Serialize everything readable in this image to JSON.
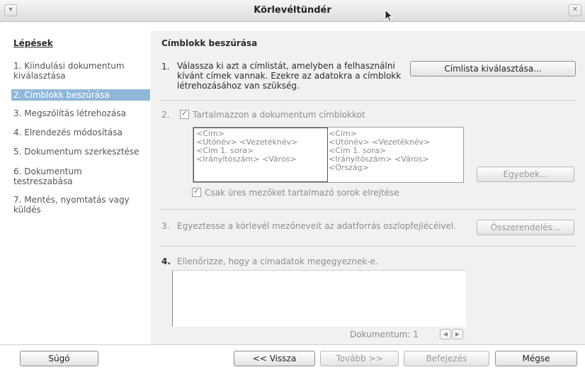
{
  "window": {
    "title": "Körlevéltündér",
    "menu_icon": "chevron-down-icon",
    "close_icon": "close-icon"
  },
  "sidebar": {
    "heading": "Lépések",
    "items": [
      {
        "label": "1. Kiindulási dokumentum kiválasztása",
        "active": false
      },
      {
        "label": "2. Címblokk beszúrása",
        "active": true
      },
      {
        "label": "3. Megszólítás létrehozása",
        "active": false
      },
      {
        "label": "4. Elrendezés módosítása",
        "active": false
      },
      {
        "label": "5. Dokumentum szerkesztése",
        "active": false
      },
      {
        "label": "6. Dokumentum testreszabása",
        "active": false
      },
      {
        "label": "7. Mentés, nyomtatás vagy küldés",
        "active": false
      }
    ]
  },
  "main": {
    "heading": "Címblokk beszúrása",
    "step1": {
      "num": "1.",
      "text": "Válassza ki azt a címlistát, amelyben a felhasználni kívánt címek vannak. Ezekre az adatokra a címblokk létrehozásához van szükség.",
      "button": "Címlista kiválasztása..."
    },
    "step2": {
      "num": "2.",
      "checkbox_label": "Tartalmazzon a dokumentum címblokkot",
      "checked": true,
      "preview_left": [
        "<Cím>",
        "<Utónév> <Vezetéknév>",
        "<Cím 1. sora>",
        "<Irányítószám> <Város>"
      ],
      "preview_right": [
        "<Cím>",
        "<Utónév> <Vezetéknév>",
        "<Cím 1. sora>",
        "<Irányítószám> <Város>",
        "<Ország>"
      ],
      "more_button": "Egyebek...",
      "hide_empty_label": "Csak üres mezőket tartalmazó sorok elrejtése",
      "hide_empty_checked": true
    },
    "step3": {
      "num": "3.",
      "text": "Egyeztesse a körlevél mezőneveit az adatforrás oszlopfejlécéivel.",
      "button": "Összerendelés..."
    },
    "step4": {
      "num": "4.",
      "text": "Ellenőrizze, hogy a címadatok megegyeznek-e.",
      "document_label": "Dokumentum: 1",
      "prev_icon": "arrow-left-icon",
      "next_icon": "arrow-right-icon"
    }
  },
  "footer": {
    "help": "Súgó",
    "back": "<< Vissza",
    "next": "Tovább >>",
    "finish": "Befejezés",
    "cancel": "Mégse"
  }
}
